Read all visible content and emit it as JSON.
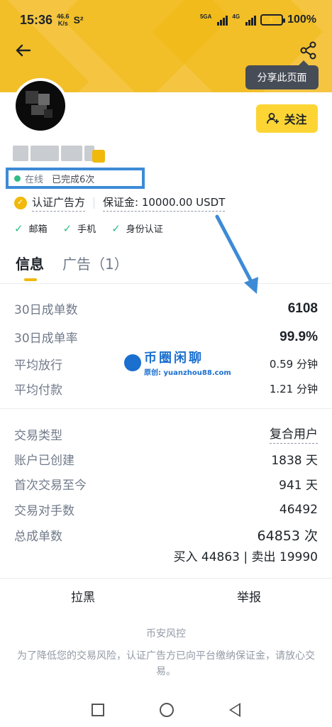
{
  "status_bar": {
    "time": "15:36",
    "speed_top": "46.6",
    "speed_bottom": "K/s",
    "extra": "S²",
    "sig1_label": "5GA",
    "sig2_label": "4G",
    "battery_pct": "100%"
  },
  "header": {
    "share_tooltip": "分享此页面"
  },
  "profile": {
    "follow_label": "关注",
    "online_label": "在线",
    "completed": "已完成6次",
    "verified_label": "认证广告方",
    "deposit_label": "保证金: 10000.00 USDT",
    "checks": [
      "邮箱",
      "手机",
      "身份认证"
    ]
  },
  "tabs": {
    "info": "信息",
    "ads": "广告（1）"
  },
  "stats": {
    "orders_30d_label": "30日成单数",
    "orders_30d": "6108",
    "rate_30d_label": "30日成单率",
    "rate_30d": "99.9%",
    "release_label": "平均放行",
    "release": "0.59 分钟",
    "pay_label": "平均付款",
    "pay": "1.21 分钟"
  },
  "watermark": {
    "title": "币圈闲聊",
    "subtitle": "原创: yuanzhou88.com"
  },
  "details": {
    "type_label": "交易类型",
    "type": "复合用户",
    "created_label": "账户已创建",
    "created": "1838 天",
    "first_label": "首次交易至今",
    "first": "941 天",
    "counterparts_label": "交易对手数",
    "counterparts": "46492",
    "total_label": "总成单数",
    "total": "64853 次",
    "buy_sell": "买入 44863 | 卖出 19990"
  },
  "actions": {
    "block": "拉黑",
    "report": "举报"
  },
  "risk": {
    "title": "币安风控",
    "desc": "为了降低您的交易风险，认证广告方已向平台缴纳保证金，请放心交易。"
  },
  "colors": {
    "brand_yellow": "#fcd535",
    "online_green": "#2ebd85",
    "annotation_blue": "#3d8bd6"
  }
}
